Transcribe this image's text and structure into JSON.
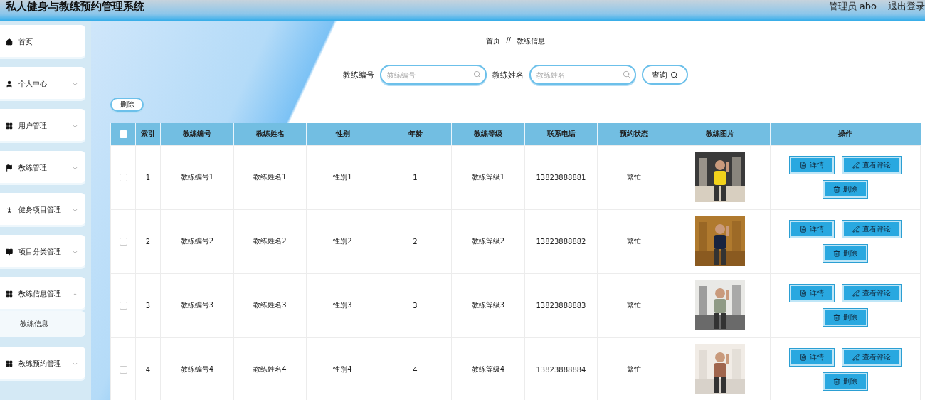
{
  "header": {
    "title": "私人健身与教练预约管理系统",
    "user": "管理员 abo",
    "logout": "退出登录"
  },
  "sidebar": {
    "items": [
      {
        "label": "首页",
        "kind": "link"
      },
      {
        "label": "个人中心",
        "kind": "menu",
        "expanded": false
      },
      {
        "label": "用户管理",
        "kind": "menu",
        "expanded": false
      },
      {
        "label": "教练管理",
        "kind": "menu",
        "expanded": false
      },
      {
        "label": "健身项目管理",
        "kind": "menu",
        "expanded": false
      },
      {
        "label": "项目分类管理",
        "kind": "menu",
        "expanded": false
      },
      {
        "label": "教练信息管理",
        "kind": "menu",
        "expanded": true,
        "children": [
          {
            "label": "教练信息",
            "selected": true
          }
        ]
      },
      {
        "label": "教练预约管理",
        "kind": "menu",
        "expanded": false
      }
    ]
  },
  "breadcrumb": {
    "home": "首页",
    "separator": "//",
    "current": "教练信息"
  },
  "search": {
    "fields": [
      {
        "label": "教练编号",
        "placeholder": "教练编号"
      },
      {
        "label": "教练姓名",
        "placeholder": "教练姓名"
      }
    ],
    "button": "查询"
  },
  "delete_button": "删除",
  "table": {
    "header_checkbox": {
      "checked": false
    },
    "columns": [
      "索引",
      "教练编号",
      "教练姓名",
      "性别",
      "年龄",
      "教练等级",
      "联系电话",
      "预约状态",
      "教练图片",
      "操作"
    ],
    "rows": [
      {
        "checked": false,
        "cells": [
          "1",
          "教练编号1",
          "教练姓名1",
          "性别1",
          "1",
          "教练等级1",
          "13823888881",
          "繁忙"
        ],
        "photo": {
          "kind": "picture"
        },
        "actions": [
          {
            "kind": "detail",
            "label": "详情"
          },
          {
            "kind": "review",
            "label": "查看评论"
          },
          {
            "kind": "delete",
            "label": "删除"
          }
        ]
      },
      {
        "checked": false,
        "cells": [
          "2",
          "教练编号2",
          "教练姓名2",
          "性别2",
          "2",
          "教练等级2",
          "13823888882",
          "繁忙"
        ],
        "photo": {
          "kind": "picture"
        },
        "actions": [
          {
            "kind": "detail",
            "label": "详情"
          },
          {
            "kind": "review",
            "label": "查看评论"
          },
          {
            "kind": "delete",
            "label": "删除"
          }
        ]
      },
      {
        "checked": false,
        "cells": [
          "3",
          "教练编号3",
          "教练姓名3",
          "性别3",
          "3",
          "教练等级3",
          "13823888883",
          "繁忙"
        ],
        "photo": {
          "kind": "picture"
        },
        "actions": [
          {
            "kind": "detail",
            "label": "详情"
          },
          {
            "kind": "review",
            "label": "查看评论"
          },
          {
            "kind": "delete",
            "label": "删除"
          }
        ]
      },
      {
        "checked": false,
        "cells": [
          "4",
          "教练编号4",
          "教练姓名4",
          "性别4",
          "4",
          "教练等级4",
          "13823888884",
          "繁忙"
        ],
        "photo": {
          "kind": "picture"
        },
        "actions": [
          {
            "kind": "detail",
            "label": "详情"
          },
          {
            "kind": "review",
            "label": "查看评论"
          },
          {
            "kind": "delete",
            "label": "删除"
          }
        ]
      }
    ]
  }
}
